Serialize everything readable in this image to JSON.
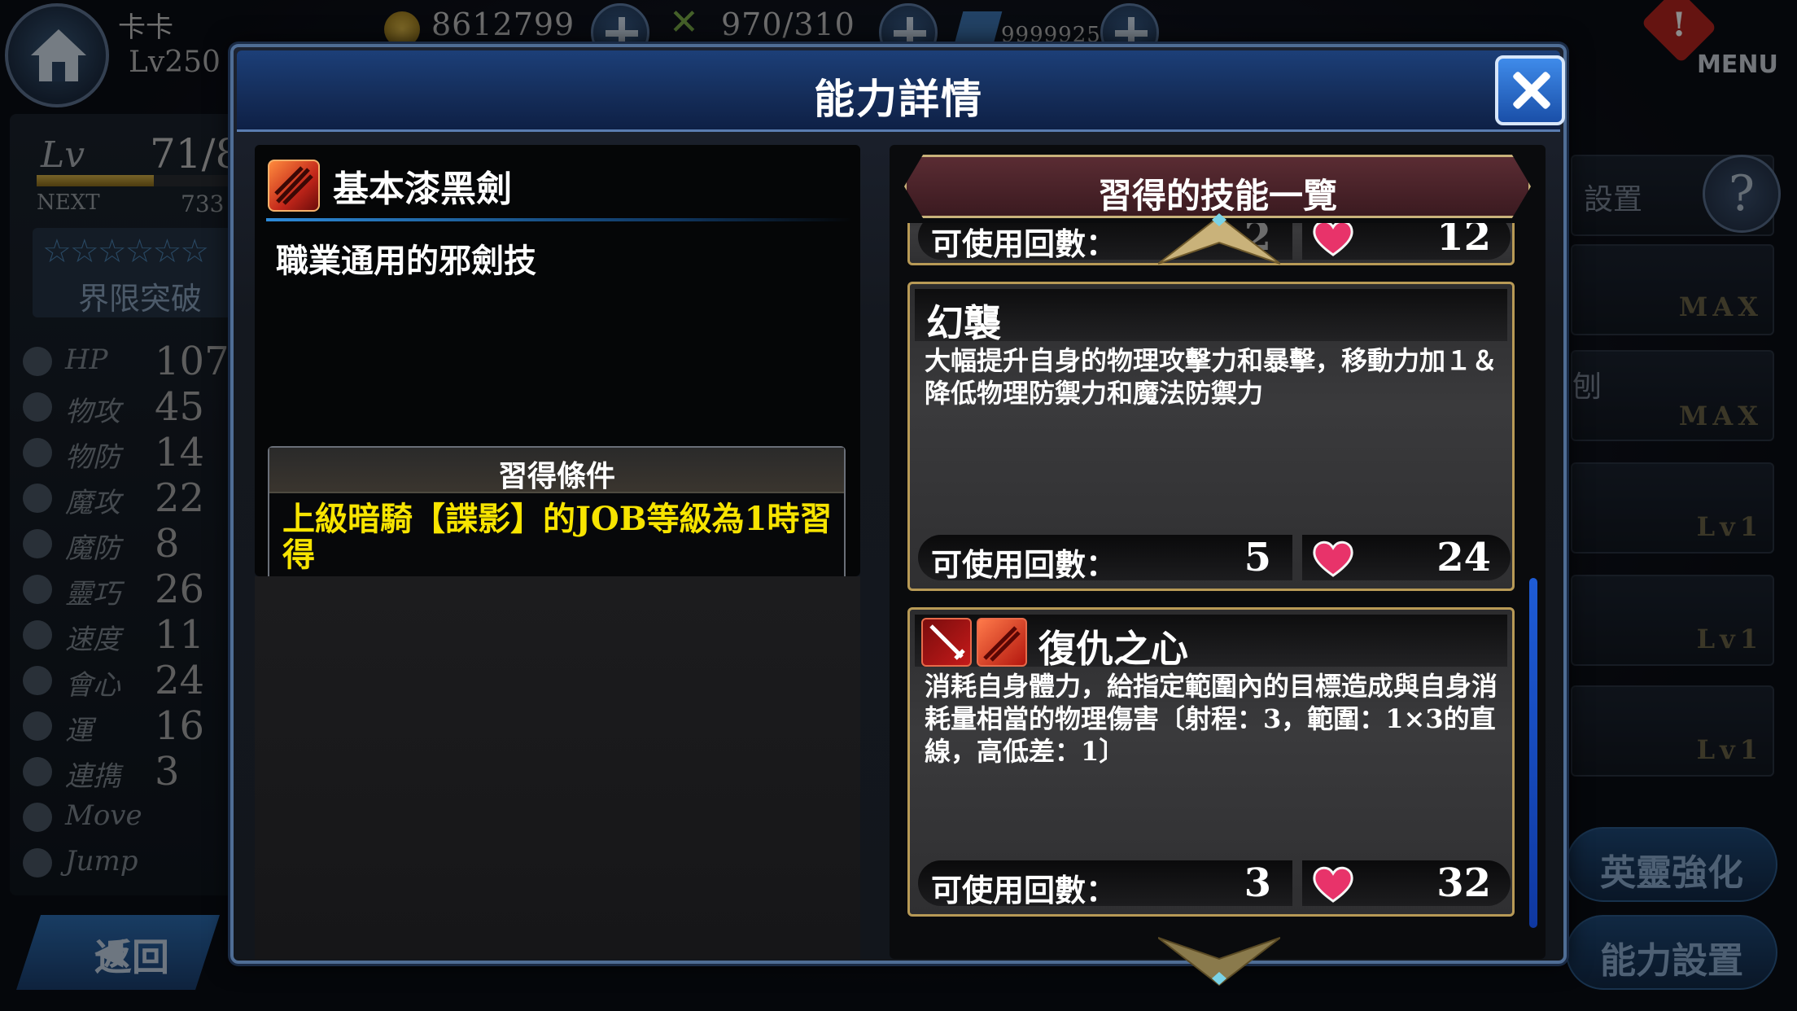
{
  "colors": {
    "accent_blue": "#1c3f78",
    "gold": "#c9b27a",
    "condition_yellow": "#f7e400",
    "heart": "#e8336a"
  },
  "topbar": {
    "player_name": "卡卡",
    "player_level": "Lv250",
    "gold": "8612799",
    "stamina": "970/310",
    "gems": "9999925",
    "alert_glyph": "!",
    "menu_label": "MENU"
  },
  "unit_panel": {
    "lv_label": "Lv",
    "lv_value": "71/8",
    "next_label": "NEXT",
    "next_value": "733",
    "stars": "☆☆☆☆☆☆",
    "limit_break": "界限突破",
    "stats": [
      {
        "name": "HP",
        "value": "107"
      },
      {
        "name": "物攻",
        "value": "45"
      },
      {
        "name": "物防",
        "value": "14"
      },
      {
        "name": "魔攻",
        "value": "22"
      },
      {
        "name": "魔防",
        "value": "8"
      },
      {
        "name": "靈巧",
        "value": "26"
      },
      {
        "name": "速度",
        "value": "11"
      },
      {
        "name": "會心",
        "value": "24"
      },
      {
        "name": "運",
        "value": "16"
      },
      {
        "name": "連擕",
        "value": "3"
      },
      {
        "name": "Move",
        "value": ""
      },
      {
        "name": "Jump",
        "value": ""
      }
    ],
    "back_label": "返回"
  },
  "side_panel": {
    "setting_label": "設置",
    "help_glyph": "?",
    "rows": [
      "MAX",
      "MAX",
      "Lv1",
      "Lv1",
      "Lv1"
    ],
    "row2_prefix": "刨",
    "enhance_label": "英靈強化",
    "ability_setting_label": "能力設置"
  },
  "modal": {
    "title": "能力詳情",
    "ability": {
      "icon": "dark-sword-icon",
      "name": "基本漆黑劍",
      "description": "職業通用的邪劍技"
    },
    "condition": {
      "title": "習得條件",
      "text": "上級暗騎【諜影】的JOB等級為1時習得"
    },
    "skill_list": {
      "title": "習得的技能一覽",
      "uses_label": "可使用回數：",
      "skills": [
        {
          "name": "",
          "description": "",
          "uses": "2",
          "cost": "12"
        },
        {
          "name": "幻襲",
          "description": "大幅提升自身的物理攻擊力和暴擊，移動力加１＆降低物理防禦力和魔法防禦力",
          "uses": "5",
          "cost": "24"
        },
        {
          "name": "復仇之心",
          "description": "消耗自身體力，給指定範圍內的目標造成與自身消耗量相當的物理傷害〔射程：3，範圍：1×3的直線，高低差：1〕",
          "uses": "3",
          "cost": "32"
        }
      ]
    }
  }
}
